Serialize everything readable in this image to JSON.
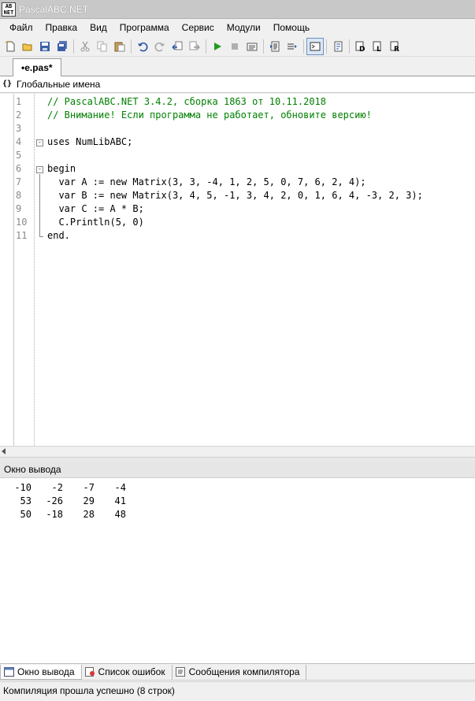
{
  "window": {
    "title": "PascalABC.NET",
    "icon_text": "AB\nNET"
  },
  "menu": {
    "items": [
      "Файл",
      "Правка",
      "Вид",
      "Программа",
      "Сервис",
      "Модули",
      "Помощь"
    ]
  },
  "toolbar": {
    "icons": [
      "new-file-icon",
      "open-icon",
      "save-icon",
      "save-all-icon",
      "cut-icon",
      "copy-icon",
      "paste-icon",
      "undo-icon",
      "redo-icon",
      "navigate-back-icon",
      "navigate-forward-icon",
      "run-icon",
      "stop-icon",
      "compile-icon",
      "format-icon",
      "debug-step-icon",
      "console-icon",
      "intellisense-icon",
      "form-d-icon",
      "form-l-icon",
      "form-r-icon"
    ]
  },
  "document_tab": {
    "label": "•e.pas*"
  },
  "scope": {
    "icon_text": "{}",
    "label": "Глобальные имена"
  },
  "editor": {
    "line_numbers": [
      "1",
      "2",
      "3",
      "4",
      "5",
      "6",
      "7",
      "8",
      "9",
      "10",
      "11"
    ],
    "lines": [
      {
        "text": "// PascalABC.NET 3.4.2, сборка 1863 от 10.11.2018",
        "kind": "comment",
        "indent": 0
      },
      {
        "text": "// Внимание! Если программа не работает, обновите версию!",
        "kind": "comment",
        "indent": 0
      },
      {
        "text": "",
        "kind": "code",
        "indent": 0
      },
      {
        "text": "uses NumLibABC;",
        "kind": "code",
        "indent": 0
      },
      {
        "text": "",
        "kind": "code",
        "indent": 0
      },
      {
        "text": "begin",
        "kind": "code",
        "indent": 0
      },
      {
        "text": "  var A := new Matrix(3, 3, -4, 1, 2, 5, 0, 7, 6, 2, 4);",
        "kind": "code",
        "indent": 0
      },
      {
        "text": "  var B := new Matrix(3, 4, 5, -1, 3, 4, 2, 0, 1, 6, 4, -3, 2, 3);",
        "kind": "code",
        "indent": 0
      },
      {
        "text": "  var C := A * B;",
        "kind": "code",
        "indent": 0
      },
      {
        "text": "  C.Println(5, 0)",
        "kind": "code",
        "indent": 0
      },
      {
        "text": "end.",
        "kind": "code",
        "indent": 0
      }
    ],
    "fold_markers": {
      "uses_line": "-",
      "begin_line": "-"
    }
  },
  "output_panel": {
    "title": "Окно вывода",
    "rows": [
      [
        "-10",
        "-2",
        "-7",
        "-4"
      ],
      [
        "53",
        "-26",
        "29",
        "41"
      ],
      [
        "50",
        "-18",
        "28",
        "48"
      ]
    ]
  },
  "bottom_tabs": [
    {
      "label": "Окно вывода",
      "icon": "output-window-icon",
      "active": true
    },
    {
      "label": "Список ошибок",
      "icon": "error-list-icon",
      "active": false
    },
    {
      "label": "Сообщения компилятора",
      "icon": "compiler-messages-icon",
      "active": false
    }
  ],
  "status": {
    "text": "Компиляция прошла успешно (8 строк)"
  },
  "colors": {
    "comment": "#008000",
    "line_number": "#8a8a8a",
    "active_tool": "#dbe7f7"
  }
}
